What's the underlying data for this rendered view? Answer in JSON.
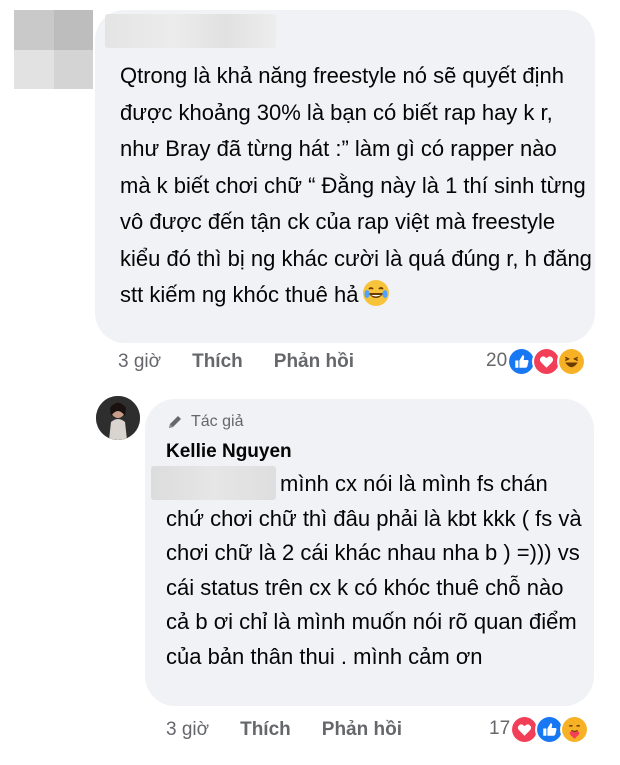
{
  "comment1": {
    "text": "Qtrong là khả năng freestyle nó sẽ quyết định được khoảng 30% là bạn có biết rap hay k r, như Bray đã từng hát :” làm gì có rapper nào mà k biết chơi chữ “ Đằng này là 1 thí sinh từng vô được đến tận ck của rap việt mà freestyle kiểu đó thì bị ng khác cười là quá đúng r, h đăng stt kiếm ng khóc thuê hả",
    "emoji": "laughing-tears-emoji",
    "time": "3 giờ",
    "like_label": "Thích",
    "reply_label": "Phản hồi",
    "reaction_count": "20",
    "reactions": [
      "like-icon",
      "love-icon",
      "haha-icon"
    ]
  },
  "comment2": {
    "badge_label": "Tác giả",
    "author": "Kellie Nguyen",
    "text": "mình cx nói là mình fs chán chứ chơi chữ thì đâu phải là kbt kkk ( fs và chơi chữ là 2 cái khác nhau nha b ) =))) vs cái status trên cx k có khóc thuê chỗ nào cả b ơi chỉ là mình muốn nói rõ quan điểm của bản thân thui . mình cảm ơn",
    "time": "3 giờ",
    "like_label": "Thích",
    "reply_label": "Phản hồi",
    "reaction_count": "17",
    "reactions": [
      "love-icon",
      "like-icon",
      "care-icon"
    ]
  },
  "colors": {
    "bubble": "#f0f2f5",
    "meta": "#65676b",
    "like": "#1877f2",
    "love": "#f33e58",
    "haha": "#f7b125"
  }
}
